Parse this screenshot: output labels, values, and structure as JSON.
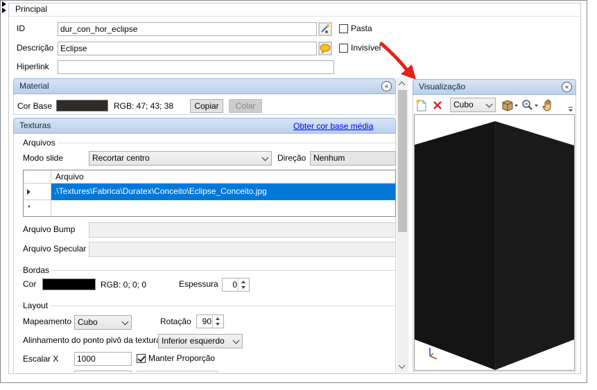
{
  "principal": {
    "title": "Principal",
    "id_label": "ID",
    "id_value": "dur_con_hor_eclipse",
    "descricao_label": "Descrição",
    "descricao_value": "Eclipse",
    "hiperlink_label": "Hiperlink",
    "hiperlink_value": "",
    "pasta_label": "Pasta",
    "invisivel_label": "Invisível"
  },
  "material": {
    "title": "Material",
    "cor_base_label": "Cor Base",
    "cor_base_color": "#2f2b26",
    "cor_base_rgb": "RGB: 47; 43; 38",
    "copiar_label": "Copiar",
    "colar_label": "Colar"
  },
  "texturas": {
    "title": "Texturas",
    "obter_link": "Obter cor base média",
    "arquivos_group": "Arquivos",
    "modo_slide_label": "Modo slide",
    "modo_slide_value": "Recortar centro",
    "direcao_label": "Direção",
    "direcao_value": "Nenhum",
    "grid_header": "Arquivo",
    "grid_rows": [
      ".\\Textures\\Fabrica\\Duratex\\Conceito\\Eclipse_Conceito.jpg"
    ],
    "new_row_marker": "*",
    "bump_label": "Arquivo Bump",
    "specular_label": "Arquivo Specular"
  },
  "bordas": {
    "group": "Bordas",
    "cor_label": "Cor",
    "cor_color": "#000000",
    "cor_rgb": "RGB: 0; 0; 0",
    "espessura_label": "Espessura",
    "espessura_value": "0"
  },
  "layout": {
    "group": "Layout",
    "mapeamento_label": "Mapeamento",
    "mapeamento_value": "Cubo",
    "rotacao_label": "Rotação",
    "rotacao_value": "90",
    "alinhamento_label": "Alinhamento do ponto pivô da textura",
    "alinhamento_value": "Inferior esquerdo",
    "escalar_x_label": "Escalar X",
    "escalar_x_value": "1000",
    "manter_label": "Manter Proporção"
  },
  "visualizacao": {
    "title": "Visualização",
    "shape_value": "Cubo",
    "toolbar_icons": [
      "new-icon",
      "delete-icon",
      "cube-view-icon",
      "zoom-icon",
      "pan-hand-icon"
    ]
  },
  "colors": {
    "accent_arrow": "#e8201a",
    "selection": "#0078d7",
    "link": "#0000ee",
    "header_blue": "#bcd0eb"
  }
}
